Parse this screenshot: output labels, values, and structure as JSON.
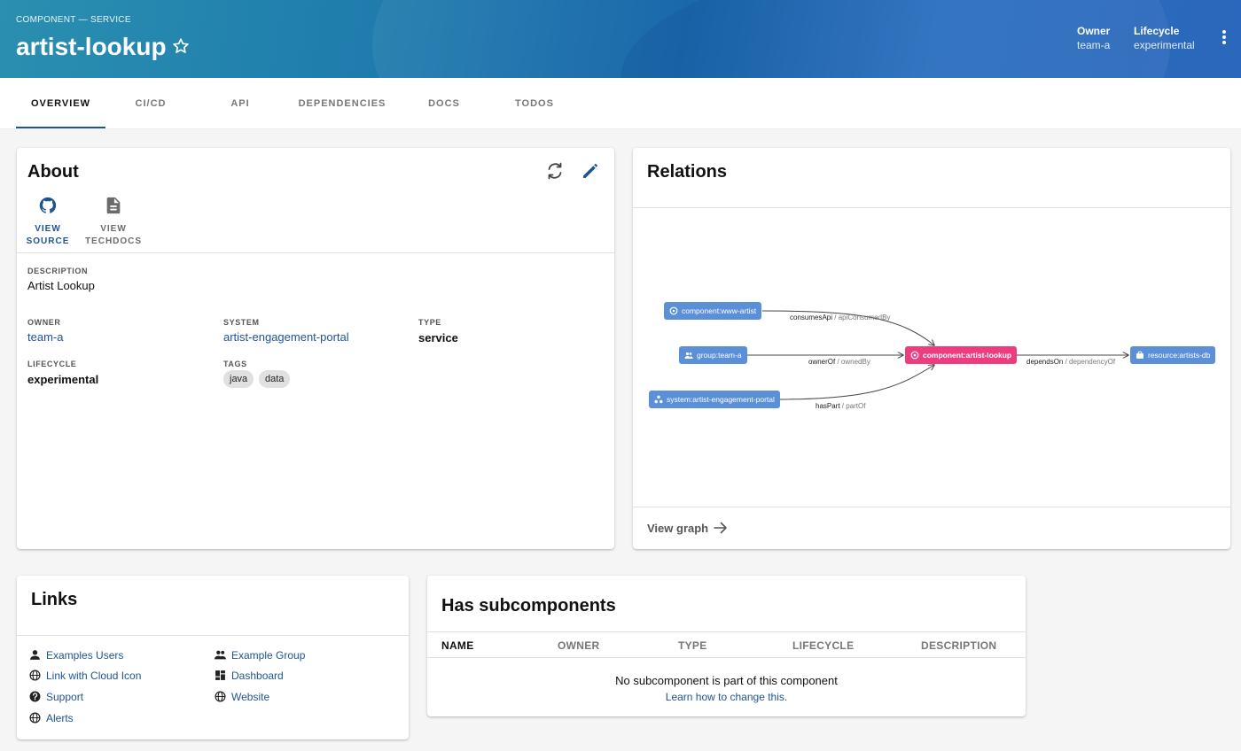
{
  "header": {
    "kind": "COMPONENT — SERVICE",
    "title": "artist-lookup",
    "owner_label": "Owner",
    "owner_value": "team-a",
    "lifecycle_label": "Lifecycle",
    "lifecycle_value": "experimental"
  },
  "tabs": [
    {
      "label": "OVERVIEW",
      "active": true
    },
    {
      "label": "CI/CD"
    },
    {
      "label": "API"
    },
    {
      "label": "DEPENDENCIES"
    },
    {
      "label": "DOCS"
    },
    {
      "label": "TODOS"
    }
  ],
  "about": {
    "title": "About",
    "view_source_1": "VIEW",
    "view_source_2": "SOURCE",
    "view_docs_1": "VIEW",
    "view_docs_2": "TECHDOCS",
    "description_label": "DESCRIPTION",
    "description": "Artist Lookup",
    "owner_label": "OWNER",
    "owner": "team-a",
    "system_label": "SYSTEM",
    "system": "artist-engagement-portal",
    "type_label": "TYPE",
    "type": "service",
    "lifecycle_label": "LIFECYCLE",
    "lifecycle": "experimental",
    "tags_label": "TAGS",
    "tags": [
      "java",
      "data"
    ]
  },
  "relations": {
    "title": "Relations",
    "nodes": {
      "www_artist": "component:www-artist",
      "team_a": "group:team-a",
      "portal": "system:artist-engagement-portal",
      "artist_lookup": "component:artist-lookup",
      "artists_db": "resource:artists-db"
    },
    "edges": {
      "consumes": "consumesApi",
      "consumes_sub": " / apiConsumedBy",
      "owner": "ownerOf",
      "owner_sub": " / ownedBy",
      "haspart": "hasPart",
      "haspart_sub": " / partOf",
      "depends": "dependsOn",
      "depends_sub": " / dependencyOf"
    },
    "view_graph": "View graph"
  },
  "links": {
    "title": "Links",
    "items": [
      {
        "label": "Examples Users",
        "icon": "person-icon"
      },
      {
        "label": "Example Group",
        "icon": "group-icon"
      },
      {
        "label": "Link with Cloud Icon",
        "icon": "globe-icon"
      },
      {
        "label": "Dashboard",
        "icon": "dashboard-icon"
      },
      {
        "label": "Support",
        "icon": "help-icon"
      },
      {
        "label": "Website",
        "icon": "globe-icon"
      },
      {
        "label": "Alerts",
        "icon": "globe-icon"
      }
    ]
  },
  "subcomponents": {
    "title": "Has subcomponents",
    "columns": [
      "NAME",
      "OWNER",
      "TYPE",
      "LIFECYCLE",
      "DESCRIPTION"
    ],
    "empty_message": "No subcomponent is part of this component",
    "empty_link": "Learn how to change this."
  },
  "colors": {
    "accent": "#1f5493",
    "node_blue": "#5b8fd8",
    "node_pink": "#ec3d7f"
  }
}
